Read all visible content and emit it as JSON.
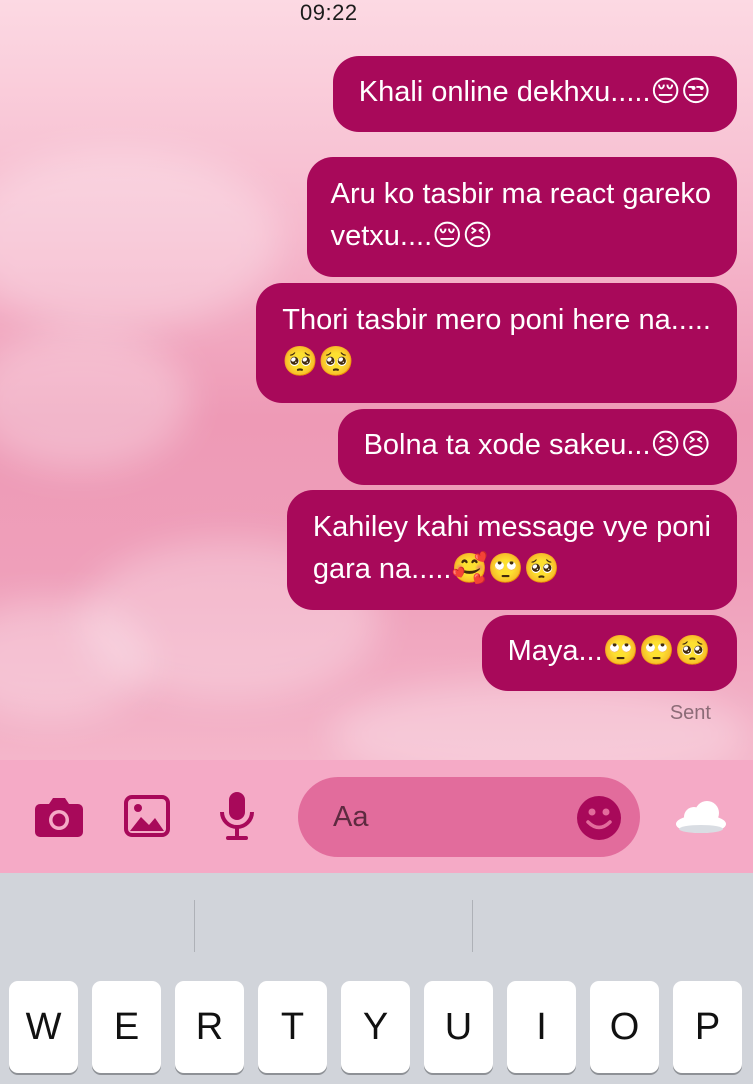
{
  "status_bar": {
    "time": "09:22"
  },
  "messages": [
    {
      "lines": [
        "Khali online dekhxu.....😔😒"
      ]
    },
    {
      "lines": [
        "Aru ko tasbir ma react gareko",
        "vetxu....😔😣"
      ]
    },
    {
      "lines": [
        "Thori tasbir mero poni here na.....",
        "🥺🥺"
      ]
    },
    {
      "lines": [
        "Bolna ta xode sakeu...😣😣"
      ]
    },
    {
      "lines": [
        "Kahiley kahi message vye poni",
        "gara na.....🥰🙄🥺"
      ]
    },
    {
      "lines": [
        "Maya...🙄🙄🥺"
      ]
    }
  ],
  "sent_status": "Sent",
  "composer": {
    "placeholder": "Aa",
    "icons": [
      "camera-icon",
      "photo-icon",
      "microphone-icon",
      "smiley-icon",
      "cloud-icon"
    ]
  },
  "keyboard": {
    "keys": [
      "W",
      "E",
      "R",
      "T",
      "Y",
      "U",
      "I",
      "O",
      "P"
    ]
  },
  "colors": {
    "bubble": "#a8095a",
    "composer_bar": "#f5aac6",
    "input_field": "#e26c9c",
    "keyboard": "#d1d4da"
  }
}
